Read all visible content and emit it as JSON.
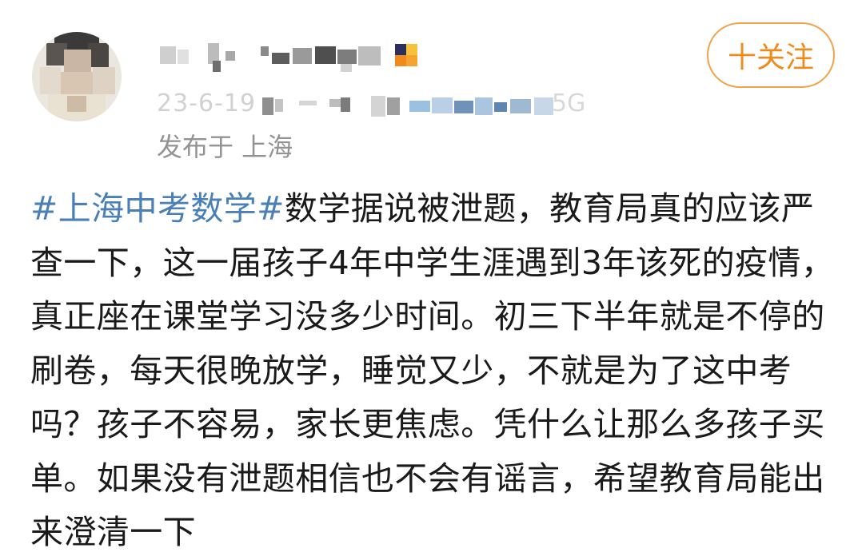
{
  "post": {
    "author": {
      "avatar_icon": "avatar-icon",
      "date": "23-6-19",
      "device_tail": "5G",
      "location": "发布于 上海",
      "has_vip_badge": true
    },
    "follow_button": {
      "label": "十关注",
      "color": "#f08a1c"
    },
    "content": {
      "hashtag": "#上海中考数学#",
      "hashtag_color": "#4a7fb7",
      "text": "数学据说被泄题，教育局真的应该严查一下，这一届孩子4年中学生涯遇到3年该死的疫情，真正座在课堂学习没多少时间。初三下半年就是不停的刷卷，每天很晚放学，睡觉又少，不就是为了这中考吗？孩子不容易，家长更焦虑。凭什么让那么多孩子买单。如果没有泄题相信也不会有谣言，希望教育局能出来澄清一下"
    }
  }
}
